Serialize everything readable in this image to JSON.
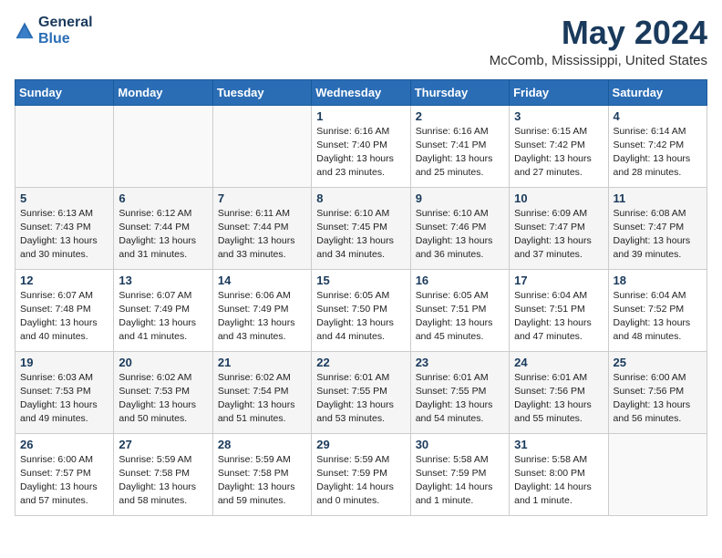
{
  "header": {
    "logo_line1": "General",
    "logo_line2": "Blue",
    "title": "May 2024",
    "subtitle": "McComb, Mississippi, United States"
  },
  "weekdays": [
    "Sunday",
    "Monday",
    "Tuesday",
    "Wednesday",
    "Thursday",
    "Friday",
    "Saturday"
  ],
  "weeks": [
    [
      {
        "day": "",
        "info": ""
      },
      {
        "day": "",
        "info": ""
      },
      {
        "day": "",
        "info": ""
      },
      {
        "day": "1",
        "info": "Sunrise: 6:16 AM\nSunset: 7:40 PM\nDaylight: 13 hours and 23 minutes."
      },
      {
        "day": "2",
        "info": "Sunrise: 6:16 AM\nSunset: 7:41 PM\nDaylight: 13 hours and 25 minutes."
      },
      {
        "day": "3",
        "info": "Sunrise: 6:15 AM\nSunset: 7:42 PM\nDaylight: 13 hours and 27 minutes."
      },
      {
        "day": "4",
        "info": "Sunrise: 6:14 AM\nSunset: 7:42 PM\nDaylight: 13 hours and 28 minutes."
      }
    ],
    [
      {
        "day": "5",
        "info": "Sunrise: 6:13 AM\nSunset: 7:43 PM\nDaylight: 13 hours and 30 minutes."
      },
      {
        "day": "6",
        "info": "Sunrise: 6:12 AM\nSunset: 7:44 PM\nDaylight: 13 hours and 31 minutes."
      },
      {
        "day": "7",
        "info": "Sunrise: 6:11 AM\nSunset: 7:44 PM\nDaylight: 13 hours and 33 minutes."
      },
      {
        "day": "8",
        "info": "Sunrise: 6:10 AM\nSunset: 7:45 PM\nDaylight: 13 hours and 34 minutes."
      },
      {
        "day": "9",
        "info": "Sunrise: 6:10 AM\nSunset: 7:46 PM\nDaylight: 13 hours and 36 minutes."
      },
      {
        "day": "10",
        "info": "Sunrise: 6:09 AM\nSunset: 7:47 PM\nDaylight: 13 hours and 37 minutes."
      },
      {
        "day": "11",
        "info": "Sunrise: 6:08 AM\nSunset: 7:47 PM\nDaylight: 13 hours and 39 minutes."
      }
    ],
    [
      {
        "day": "12",
        "info": "Sunrise: 6:07 AM\nSunset: 7:48 PM\nDaylight: 13 hours and 40 minutes."
      },
      {
        "day": "13",
        "info": "Sunrise: 6:07 AM\nSunset: 7:49 PM\nDaylight: 13 hours and 41 minutes."
      },
      {
        "day": "14",
        "info": "Sunrise: 6:06 AM\nSunset: 7:49 PM\nDaylight: 13 hours and 43 minutes."
      },
      {
        "day": "15",
        "info": "Sunrise: 6:05 AM\nSunset: 7:50 PM\nDaylight: 13 hours and 44 minutes."
      },
      {
        "day": "16",
        "info": "Sunrise: 6:05 AM\nSunset: 7:51 PM\nDaylight: 13 hours and 45 minutes."
      },
      {
        "day": "17",
        "info": "Sunrise: 6:04 AM\nSunset: 7:51 PM\nDaylight: 13 hours and 47 minutes."
      },
      {
        "day": "18",
        "info": "Sunrise: 6:04 AM\nSunset: 7:52 PM\nDaylight: 13 hours and 48 minutes."
      }
    ],
    [
      {
        "day": "19",
        "info": "Sunrise: 6:03 AM\nSunset: 7:53 PM\nDaylight: 13 hours and 49 minutes."
      },
      {
        "day": "20",
        "info": "Sunrise: 6:02 AM\nSunset: 7:53 PM\nDaylight: 13 hours and 50 minutes."
      },
      {
        "day": "21",
        "info": "Sunrise: 6:02 AM\nSunset: 7:54 PM\nDaylight: 13 hours and 51 minutes."
      },
      {
        "day": "22",
        "info": "Sunrise: 6:01 AM\nSunset: 7:55 PM\nDaylight: 13 hours and 53 minutes."
      },
      {
        "day": "23",
        "info": "Sunrise: 6:01 AM\nSunset: 7:55 PM\nDaylight: 13 hours and 54 minutes."
      },
      {
        "day": "24",
        "info": "Sunrise: 6:01 AM\nSunset: 7:56 PM\nDaylight: 13 hours and 55 minutes."
      },
      {
        "day": "25",
        "info": "Sunrise: 6:00 AM\nSunset: 7:56 PM\nDaylight: 13 hours and 56 minutes."
      }
    ],
    [
      {
        "day": "26",
        "info": "Sunrise: 6:00 AM\nSunset: 7:57 PM\nDaylight: 13 hours and 57 minutes."
      },
      {
        "day": "27",
        "info": "Sunrise: 5:59 AM\nSunset: 7:58 PM\nDaylight: 13 hours and 58 minutes."
      },
      {
        "day": "28",
        "info": "Sunrise: 5:59 AM\nSunset: 7:58 PM\nDaylight: 13 hours and 59 minutes."
      },
      {
        "day": "29",
        "info": "Sunrise: 5:59 AM\nSunset: 7:59 PM\nDaylight: 14 hours and 0 minutes."
      },
      {
        "day": "30",
        "info": "Sunrise: 5:58 AM\nSunset: 7:59 PM\nDaylight: 14 hours and 1 minute."
      },
      {
        "day": "31",
        "info": "Sunrise: 5:58 AM\nSunset: 8:00 PM\nDaylight: 14 hours and 1 minute."
      },
      {
        "day": "",
        "info": ""
      }
    ]
  ]
}
